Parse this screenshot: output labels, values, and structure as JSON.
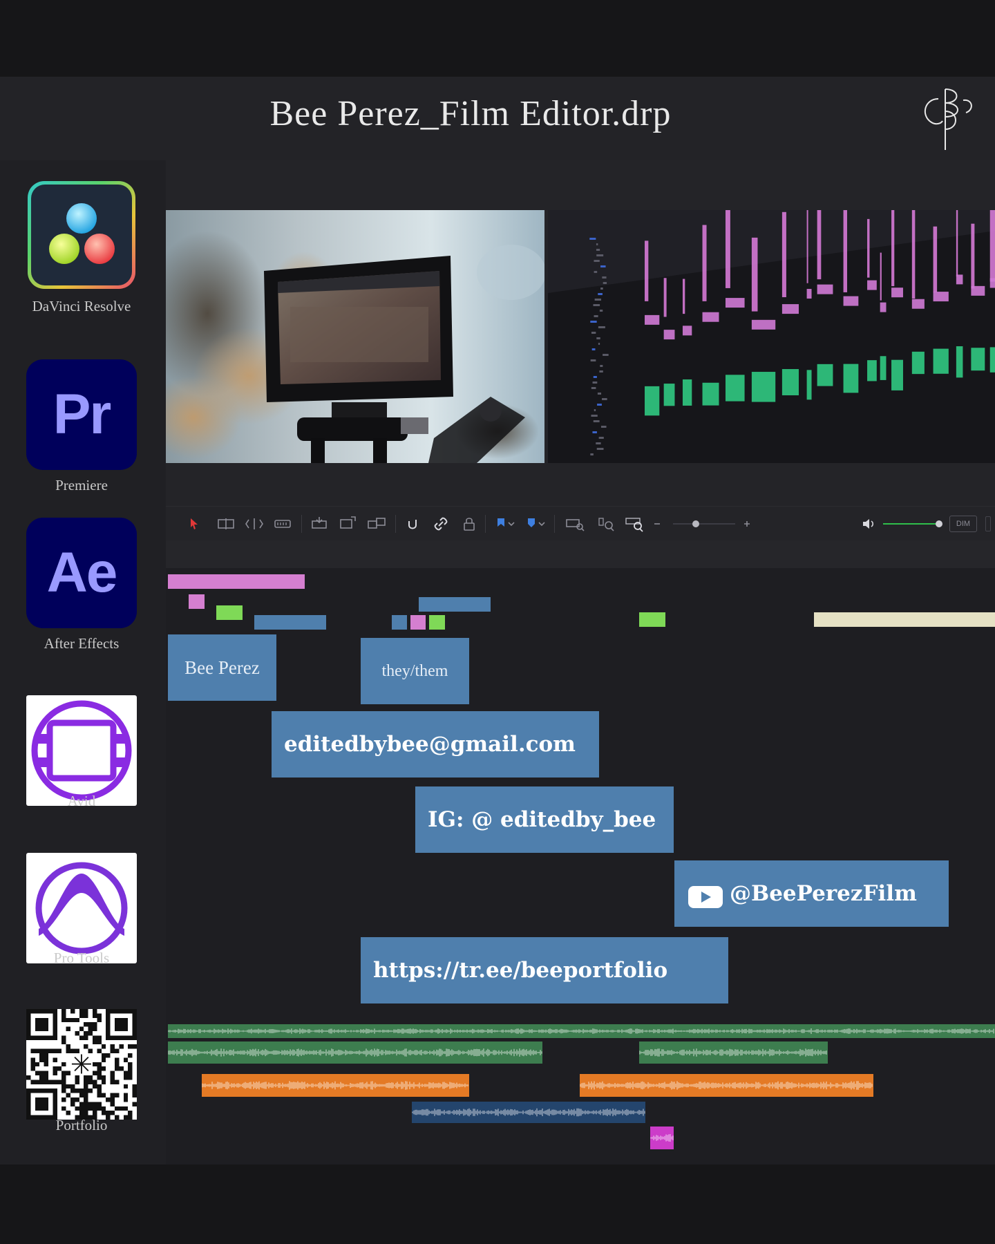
{
  "window": {
    "title": "Bee Perez_Film Editor.drp"
  },
  "brand": {
    "monogram": "BP"
  },
  "sidebar": {
    "apps": [
      {
        "label": "DaVinci Resolve",
        "icon": "davinci-resolve-icon"
      },
      {
        "label": "Premiere",
        "icon": "premiere-icon",
        "glyph": "Pr"
      },
      {
        "label": "After Effects",
        "icon": "after-effects-icon",
        "glyph": "Ae"
      },
      {
        "label": "Avid",
        "icon": "avid-icon"
      },
      {
        "label": "Pro Tools",
        "icon": "pro-tools-icon"
      },
      {
        "label": "Portfolio",
        "icon": "qr-code-icon"
      }
    ]
  },
  "toolbar": {
    "dim_label": "DIM"
  },
  "timeline": {
    "clips": {
      "name": "Bee Perez",
      "pronouns": "they/them",
      "email": "editedbybee@gmail.com",
      "instagram": "IG: @ editedby_bee",
      "youtube": "@BeePerezFilm",
      "link": "https://tr.ee/beeportfolio"
    }
  },
  "colors": {
    "clip_blue": "#4f7fad",
    "clip_pink": "#d57fd0",
    "clip_green": "#7fd957",
    "clip_beige": "#e5e1c4",
    "audio_green": "#3d7d4f",
    "audio_orange": "#e47a25",
    "audio_navy": "#24456d",
    "audio_magenta": "#cc3cc9"
  }
}
